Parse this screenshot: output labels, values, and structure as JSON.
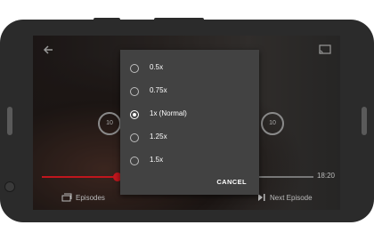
{
  "header": {
    "title": ""
  },
  "speed_dialog": {
    "options": [
      {
        "label": "0.5x",
        "selected": false
      },
      {
        "label": "0.75x",
        "selected": false
      },
      {
        "label": "1x (Normal)",
        "selected": true
      },
      {
        "label": "1.25x",
        "selected": false
      },
      {
        "label": "1.5x",
        "selected": false
      }
    ],
    "cancel_label": "CANCEL"
  },
  "player": {
    "skip_back": "10",
    "skip_forward": "10",
    "time_remaining": "18:20",
    "progress": 0.28,
    "episodes_label": "Episodes",
    "next_episode_label": "Next Episode"
  },
  "colors": {
    "accent": "#c0161d",
    "dialog_bg": "#424242"
  }
}
